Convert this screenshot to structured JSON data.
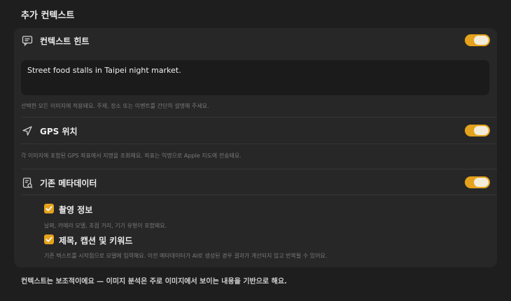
{
  "section": {
    "title": "추가 컨텍스트"
  },
  "context_hint": {
    "label": "컨텍스트 힌트",
    "icon": "chat-bubble-icon",
    "enabled": true,
    "value": "Street food stalls in Taipei night market.",
    "helper": "선택한 모든 이미지에 적용돼요. 주제, 장소 또는 이벤트를 간단히 설명해 주세요."
  },
  "gps": {
    "label": "GPS 위치",
    "icon": "location-arrow-icon",
    "enabled": true,
    "helper": "각 이미지에 포함된 GPS 좌표에서 지명을 조회해요. 좌표는 익명으로 Apple 지도에 전송돼요."
  },
  "metadata": {
    "label": "기존 메타데이터",
    "icon": "document-tag-icon",
    "enabled": true,
    "options": [
      {
        "label": "촬영 정보",
        "checked": true,
        "helper": "날짜, 카메라 모델, 초점 거리, 기기 유형이 포함돼요."
      },
      {
        "label": "제목, 캡션 및 키워드",
        "checked": true,
        "helper": "기존 텍스트를 시작점으로 모델에 입력해요. 이전 메타데이터가 AI로 생성된 경우 결과가 개선되지 않고 반복될 수 있어요."
      }
    ]
  },
  "footer": {
    "note": "컨텍스트는 보조적이에요 — 이미지 분석은 주로 이미지에서 보이는 내용을 기반으로 해요."
  },
  "colors": {
    "accent": "#e5a21c",
    "background": "#1e1e1e",
    "panel": "#272727"
  }
}
